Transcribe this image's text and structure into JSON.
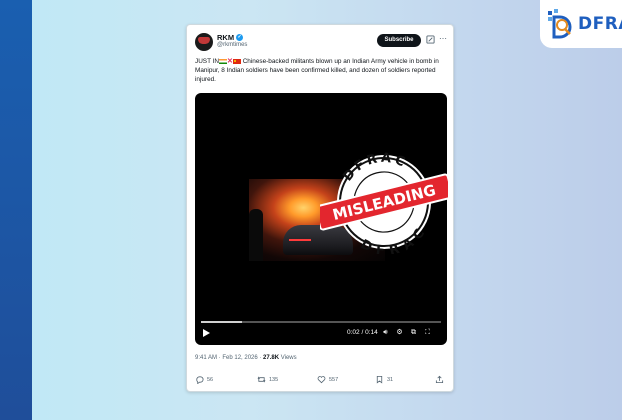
{
  "tweet": {
    "display_name": "RKM",
    "handle": "@rkmtimes",
    "subscribe_label": "Subscribe",
    "text_prefix": "JUST IN",
    "text_body": "Chinese-backed militants blown up an Indian Army vehicle in bomb in Manipur, 8 Indian soldiers have been confirmed killed, and dozen of soldiers reported injured.",
    "timestamp": "9:41 AM · Feb 12, 2026 ·",
    "views_count": "27.8K",
    "views_label": "Views",
    "video": {
      "time": "0:02 / 0:14",
      "progress": 0.17
    },
    "actions": {
      "replies": "56",
      "reposts": "135",
      "likes": "557",
      "bookmarks": "31"
    }
  },
  "stamp": {
    "top_text": "DFRAC",
    "bottom_text": "DFRAC",
    "verdict": "MISLEADING",
    "color": "#e3262e"
  },
  "brand": {
    "logo_text": "DFRA",
    "color": "#1f5fbf"
  }
}
